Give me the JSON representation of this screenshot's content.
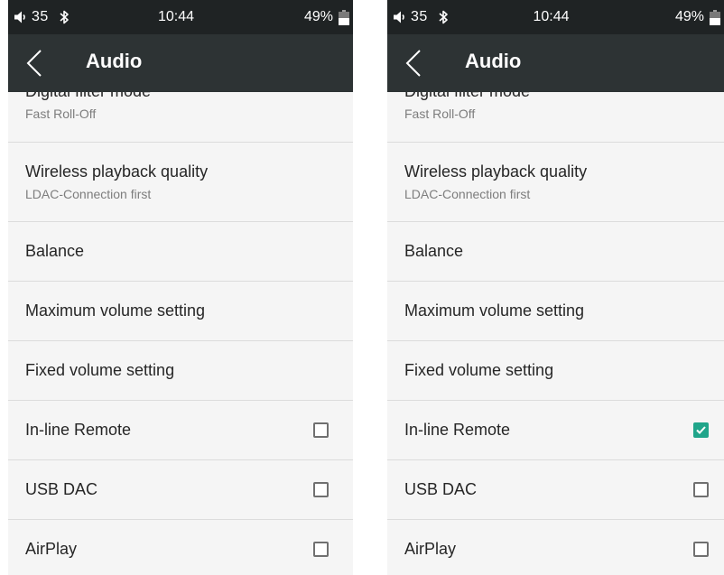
{
  "screens": [
    {
      "status": {
        "volume": "35",
        "time": "10:44",
        "battery": "49%"
      },
      "title": "Audio",
      "rows": [
        {
          "title": "Digital filter mode",
          "subtitle": "Fast Roll-Off"
        },
        {
          "title": "Wireless playback quality",
          "subtitle": "LDAC-Connection first"
        },
        {
          "title": "Balance"
        },
        {
          "title": "Maximum volume setting"
        },
        {
          "title": "Fixed volume setting"
        },
        {
          "title": "In-line Remote",
          "checked": false
        },
        {
          "title": "USB DAC",
          "checked": false
        },
        {
          "title": "AirPlay",
          "checked": false
        }
      ]
    },
    {
      "status": {
        "volume": "35",
        "time": "10:44",
        "battery": "49%"
      },
      "title": "Audio",
      "rows": [
        {
          "title": "Digital filter mode",
          "subtitle": "Fast Roll-Off"
        },
        {
          "title": "Wireless playback quality",
          "subtitle": "LDAC-Connection first"
        },
        {
          "title": "Balance"
        },
        {
          "title": "Maximum volume setting"
        },
        {
          "title": "Fixed volume setting"
        },
        {
          "title": "In-line Remote",
          "checked": true
        },
        {
          "title": "USB DAC",
          "checked": false
        },
        {
          "title": "AirPlay",
          "checked": false
        }
      ]
    }
  ],
  "icons": {
    "volume": "speaker-icon",
    "bluetooth": "bluetooth-icon",
    "battery": "battery-icon",
    "back": "back-arrow-icon",
    "check": "checkmark-icon"
  },
  "colors": {
    "statusbar": "#1f2324",
    "appbar": "#2d3334",
    "background": "#f5f5f5",
    "accent": "#20a58a",
    "divider": "#dcdcdc"
  }
}
